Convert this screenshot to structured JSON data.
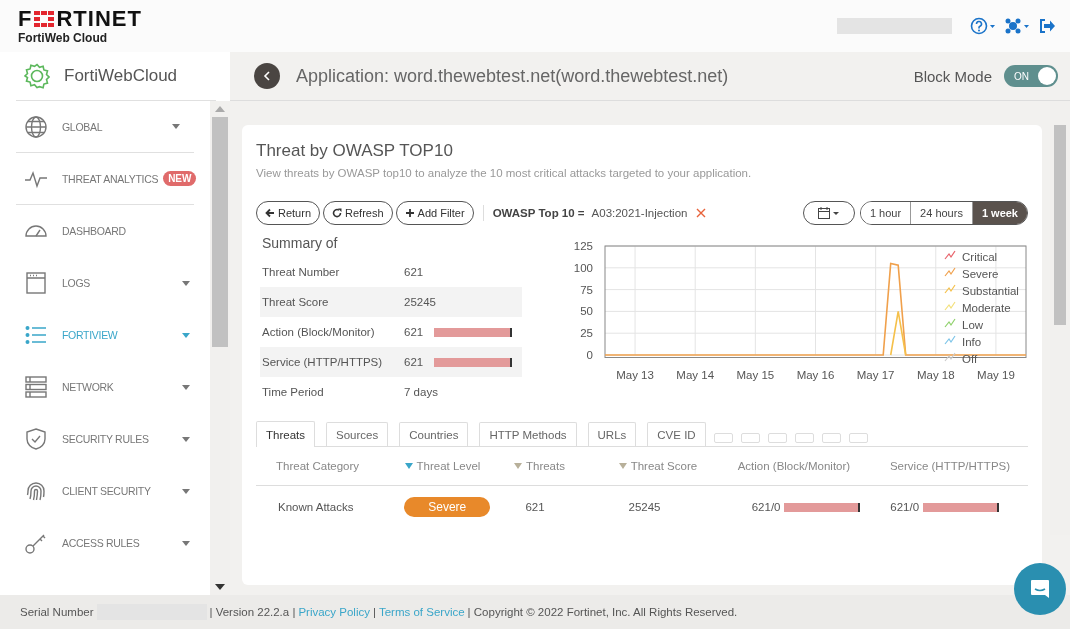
{
  "header": {
    "logo": {
      "before": "F",
      "after": "RTINET"
    },
    "product": "FortiWeb Cloud"
  },
  "sidebar": {
    "title": "FortiWebCloud",
    "items": [
      {
        "kind": "globe",
        "label": "GLOBAL",
        "caret": true,
        "selected": false
      },
      {
        "kind": "pulse",
        "label": "THREAT ANALYTICS",
        "badge": "NEW",
        "caret": false,
        "selected": false
      },
      {
        "kind": "gauge",
        "label": "DASHBOARD",
        "caret": false,
        "selected": false
      },
      {
        "kind": "window",
        "label": "LOGS",
        "caret": true,
        "selected": false
      },
      {
        "kind": "list",
        "label": "FORTIVIEW",
        "caret": true,
        "selected": true
      },
      {
        "kind": "server",
        "label": "NETWORK",
        "caret": true,
        "selected": false
      },
      {
        "kind": "shield",
        "label": "SECURITY RULES",
        "caret": true,
        "selected": false
      },
      {
        "kind": "fingerprint",
        "label": "CLIENT SECURITY",
        "caret": true,
        "selected": false
      },
      {
        "kind": "key",
        "label": "ACCESS RULES",
        "caret": true,
        "selected": false
      }
    ]
  },
  "app_bar": {
    "title": "Application: word.thewebtest.net(word.thewebtest.net)",
    "block_mode": {
      "label": "Block Mode",
      "on": true,
      "text": "ON"
    }
  },
  "panel": {
    "title": "Threat by OWASP TOP10",
    "subtitle": "View threats by OWASP top10 to analyze the 10 most critical attacks targeted to your application.",
    "actions": [
      {
        "kind": "back",
        "label": "Return"
      },
      {
        "kind": "refresh",
        "label": "Refresh"
      },
      {
        "kind": "add",
        "label": "Add Filter"
      }
    ],
    "filter": {
      "key": "OWASP Top 10 =",
      "value": "A03:2021-Injection"
    },
    "ranges": [
      {
        "label": "1 hour",
        "selected": false
      },
      {
        "label": "24 hours",
        "selected": false
      },
      {
        "label": "1 week",
        "selected": true
      }
    ],
    "summary": {
      "title": "Summary of",
      "rows": [
        {
          "label": "Threat Number",
          "value": "621"
        },
        {
          "label": "Threat Score",
          "value": "25245"
        },
        {
          "label": "Action (Block/Monitor)",
          "value": "621",
          "level": 1
        },
        {
          "label": "Service (HTTP/HTTPS)",
          "value": "621",
          "level": 1
        },
        {
          "label": "Time Period",
          "value": "7 days"
        }
      ]
    },
    "chart_data": {
      "type": "line",
      "grid": true,
      "legend": true,
      "categories": [
        null,
        null,
        null,
        null,
        "May 13",
        null,
        null,
        null,
        null,
        null,
        null,
        null,
        "May 14",
        null,
        null,
        null,
        null,
        null,
        null,
        null,
        "May 15",
        null,
        null,
        null,
        null,
        null,
        null,
        null,
        "May 16",
        null,
        null,
        null,
        null,
        null,
        null,
        null,
        "May 17",
        null,
        null,
        null,
        null,
        null,
        null,
        null,
        "May 18",
        null,
        null,
        null,
        null,
        null,
        null,
        null,
        "May 19",
        null,
        null,
        null,
        null
      ],
      "ylim": [
        0,
        125
      ],
      "yticks": [
        0,
        25,
        50,
        75,
        100,
        125
      ],
      "series": [
        {
          "name": "Critical",
          "color": "#e8636b",
          "values": [
            null,
            null,
            null,
            null,
            null,
            null,
            null,
            null,
            null,
            null,
            null,
            null,
            null,
            null,
            null,
            null,
            null,
            null,
            null,
            null,
            null,
            null,
            null,
            null,
            null,
            null,
            null,
            null,
            null,
            null,
            null,
            null,
            null,
            null,
            null,
            null,
            null,
            null,
            null,
            null,
            null,
            null,
            null,
            null,
            null,
            null,
            null,
            null,
            null,
            null,
            null,
            null,
            null,
            null,
            null,
            null,
            null
          ]
        },
        {
          "name": "Severe",
          "color": "#f0a04b",
          "values": [
            0,
            0,
            0,
            0,
            0,
            0,
            0,
            0,
            0,
            0,
            0,
            0,
            0,
            0,
            0,
            0,
            0,
            0,
            0,
            0,
            0,
            0,
            0,
            0,
            0,
            0,
            0,
            0,
            0,
            0,
            0,
            0,
            0,
            0,
            0,
            0,
            0,
            0,
            105,
            103,
            0,
            0,
            0,
            0,
            0,
            0,
            0,
            0,
            0,
            0,
            0,
            0,
            0,
            0,
            0,
            0,
            0
          ]
        },
        {
          "name": "Substantial",
          "color": "#f5c04a",
          "values": [
            null,
            null,
            null,
            null,
            null,
            null,
            null,
            null,
            null,
            null,
            null,
            null,
            null,
            null,
            null,
            null,
            null,
            null,
            null,
            null,
            null,
            null,
            null,
            null,
            null,
            null,
            null,
            null,
            null,
            null,
            null,
            null,
            null,
            null,
            null,
            null,
            null,
            null,
            0,
            50,
            0,
            null,
            null,
            null,
            null,
            null,
            null,
            null,
            null,
            null,
            null,
            null,
            null,
            null,
            null,
            null,
            null
          ]
        },
        {
          "name": "Moderate",
          "color": "#f3e07a",
          "values": [
            null,
            null,
            null,
            null,
            null,
            null,
            null,
            null,
            null,
            null,
            null,
            null,
            null,
            null,
            null,
            null,
            null,
            null,
            null,
            null,
            null,
            null,
            null,
            null,
            null,
            null,
            null,
            null,
            null,
            null,
            null,
            null,
            null,
            null,
            null,
            null,
            null,
            null,
            null,
            null,
            null,
            null,
            null,
            null,
            null,
            null,
            null,
            null,
            null,
            null,
            null,
            null,
            null,
            null,
            null,
            null,
            null
          ]
        },
        {
          "name": "Low",
          "color": "#8fd16b",
          "values": [
            null,
            null,
            null,
            null,
            null,
            null,
            null,
            null,
            null,
            null,
            null,
            null,
            null,
            null,
            null,
            null,
            null,
            null,
            null,
            null,
            null,
            null,
            null,
            null,
            null,
            null,
            null,
            null,
            null,
            null,
            null,
            null,
            null,
            null,
            null,
            null,
            null,
            null,
            null,
            null,
            null,
            null,
            null,
            null,
            null,
            null,
            null,
            null,
            null,
            null,
            null,
            null,
            null,
            null,
            null,
            null,
            null
          ]
        },
        {
          "name": "Info",
          "color": "#7cc4e8",
          "values": [
            null,
            null,
            null,
            null,
            null,
            null,
            null,
            null,
            null,
            null,
            null,
            null,
            null,
            null,
            null,
            null,
            null,
            null,
            null,
            null,
            null,
            null,
            null,
            null,
            null,
            null,
            null,
            null,
            null,
            null,
            null,
            null,
            null,
            null,
            null,
            null,
            null,
            null,
            null,
            null,
            null,
            null,
            null,
            null,
            null,
            null,
            null,
            null,
            null,
            null,
            null,
            null,
            null,
            null,
            null,
            null,
            null
          ]
        },
        {
          "name": "Off",
          "color": "#cccccc",
          "values": [
            null,
            null,
            null,
            null,
            null,
            null,
            null,
            null,
            null,
            null,
            null,
            null,
            null,
            null,
            null,
            null,
            null,
            null,
            null,
            null,
            null,
            null,
            null,
            null,
            null,
            null,
            null,
            null,
            null,
            null,
            null,
            null,
            null,
            null,
            null,
            null,
            null,
            null,
            null,
            null,
            null,
            null,
            null,
            null,
            null,
            null,
            null,
            null,
            null,
            null,
            null,
            null,
            null,
            null,
            null,
            null,
            null
          ]
        }
      ]
    },
    "tabs": [
      {
        "label": "Threats",
        "selected": true
      },
      {
        "label": "Sources",
        "selected": false
      },
      {
        "label": "Countries",
        "selected": false
      },
      {
        "label": "HTTP Methods",
        "selected": false
      },
      {
        "label": "URLs",
        "selected": false
      },
      {
        "label": "CVE ID",
        "selected": false
      }
    ],
    "table": {
      "columns": [
        {
          "label": "Threat Category",
          "sortable": false
        },
        {
          "label": "Threat Level",
          "sortable": true,
          "sorted": true
        },
        {
          "label": "Threats",
          "sortable": true,
          "sorted": false
        },
        {
          "label": "Threat Score",
          "sortable": true,
          "sorted": false
        },
        {
          "label": "Action (Block/Monitor)",
          "sortable": false
        },
        {
          "label": "Service (HTTP/HTTPS)",
          "sortable": false
        }
      ],
      "rows": [
        {
          "category": "Known Attacks",
          "threat_level": {
            "text": "Severe",
            "color": "#e8892a"
          },
          "threats": "621",
          "score": "25245",
          "action": {
            "text": "621/0",
            "level": 1
          },
          "service": {
            "text": "621/0",
            "level": 1
          }
        }
      ]
    }
  },
  "footer": {
    "serial_label": "Serial Number",
    "version": "| Version 22.2.a |",
    "privacy": "Privacy Policy",
    "sep": "|",
    "terms": "Terms of Service",
    "copyright": "| Copyright © 2022 Fortinet, Inc. All Rights Reserved."
  }
}
